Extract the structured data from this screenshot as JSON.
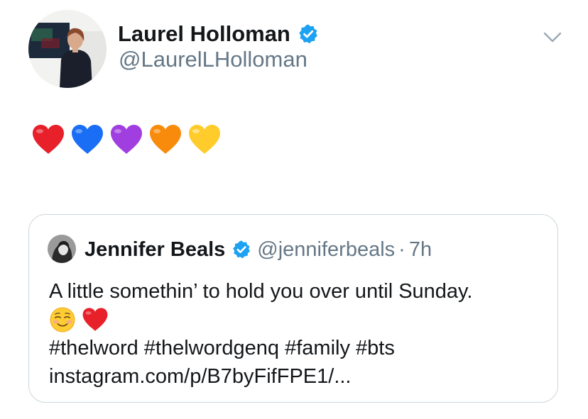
{
  "author": {
    "name": "Laurel Holloman",
    "handle": "@LaurelLHolloman",
    "verified": true
  },
  "body": {
    "hearts": [
      {
        "icon": "red-heart-icon",
        "color": "#e8202a"
      },
      {
        "icon": "blue-heart-icon",
        "color": "#1a6ef5"
      },
      {
        "icon": "purple-heart-icon",
        "color": "#a13ee0"
      },
      {
        "icon": "orange-heart-icon",
        "color": "#f98b0c"
      },
      {
        "icon": "yellow-heart-icon",
        "color": "#ffcc2b"
      }
    ]
  },
  "quoted_tweet": {
    "name": "Jennifer Beals",
    "handle": "@jenniferbeals",
    "separator": "·",
    "time": "7h",
    "verified": true,
    "text_line1": "A little somethin’ to hold you over until Sunday.",
    "emojis": [
      "smiling-face-icon",
      "red-heart-icon"
    ],
    "hashtags": "#thelword #thelwordgenq #family #bts",
    "link": "instagram.com/p/B7byFifFPE1/..."
  },
  "colors": {
    "text_primary": "#14171a",
    "text_secondary": "#657786",
    "verified_blue": "#1da1f2",
    "border": "#ccd6dd"
  }
}
